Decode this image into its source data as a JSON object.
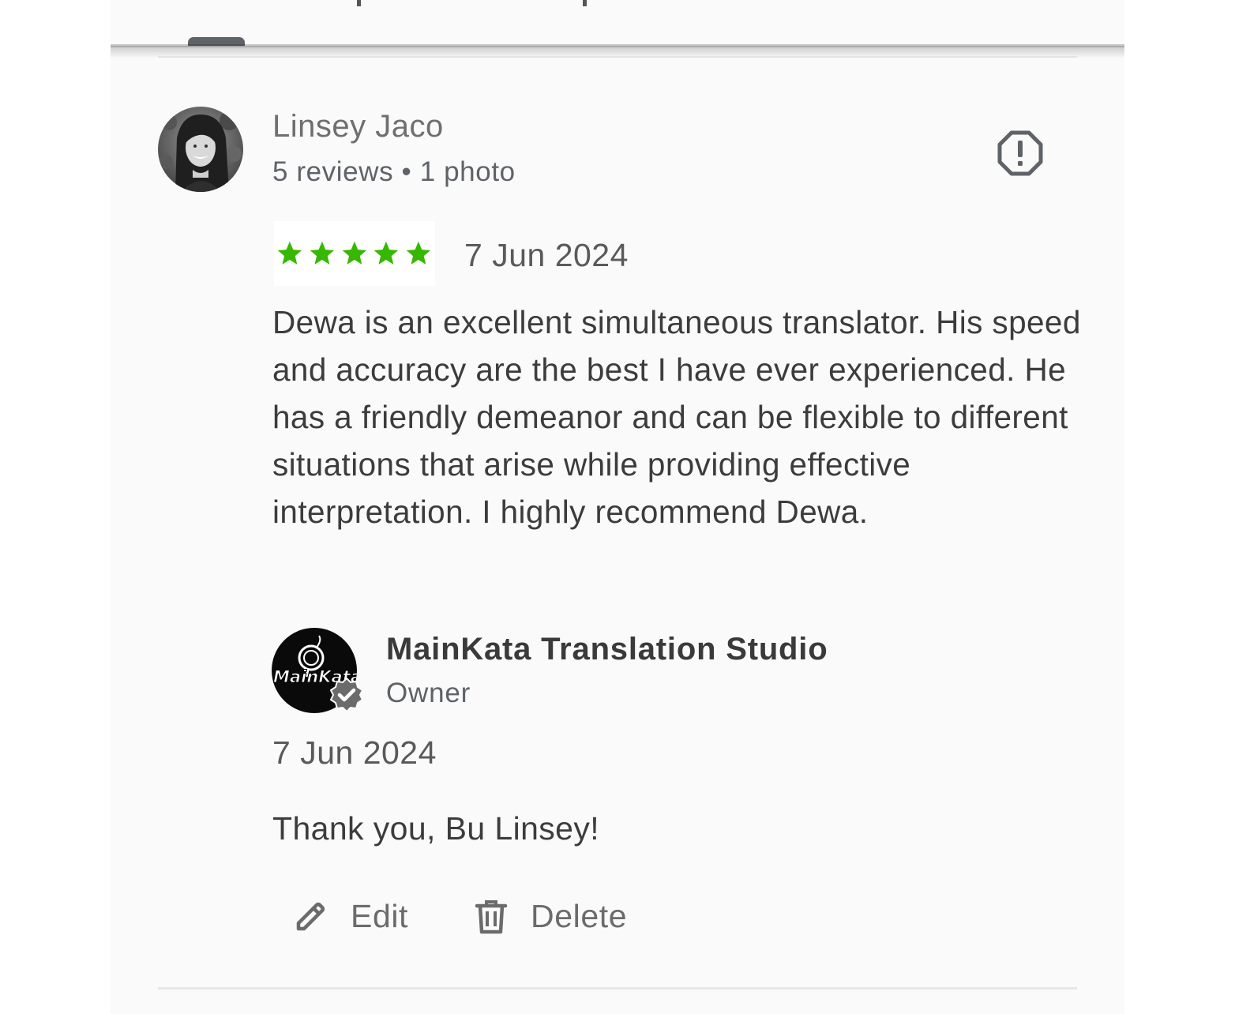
{
  "review": {
    "reviewer": {
      "name": "Linsey Jaco",
      "meta": "5 reviews • 1 photo"
    },
    "rating": 5,
    "star_color": "#37b800",
    "date": "7 Jun 2024",
    "text": "Dewa is an excellent simultaneous translator. His speed and accuracy are the best I have ever experienced. He has a friendly demeanor and can be flexible to different situations that arise while providing effective interpretation. I highly recommend Dewa.",
    "report_icon": "report-octagon-icon"
  },
  "owner_reply": {
    "owner_name": "MainKata Translation Studio",
    "role": "Owner",
    "logo_text": "MainKata",
    "date": "7 Jun 2024",
    "text": "Thank you, Bu Linsey!"
  },
  "actions": {
    "edit_label": "Edit",
    "edit_icon": "pencil-icon",
    "delete_label": "Delete",
    "delete_icon": "trash-icon"
  }
}
